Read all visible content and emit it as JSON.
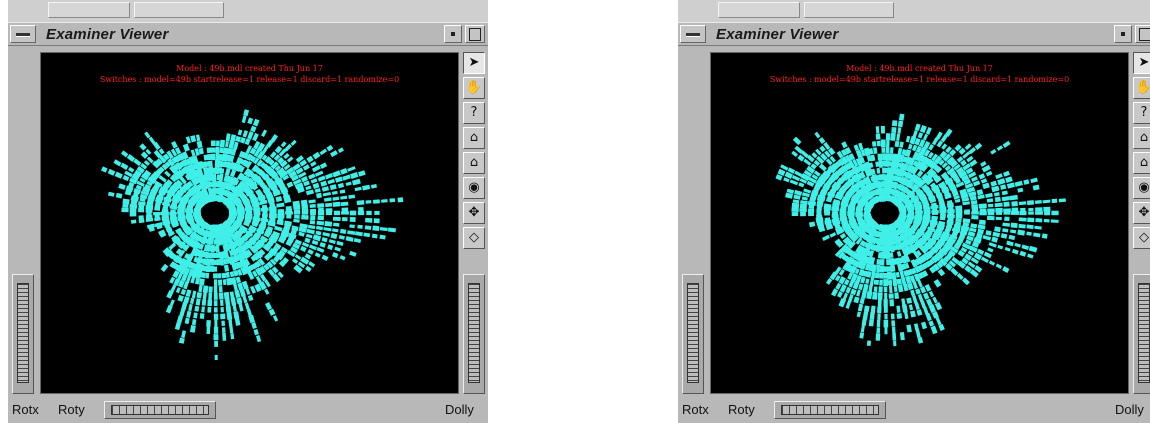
{
  "viewers": [
    {
      "title": "Examiner Viewer",
      "info_line1": "Model : 49b.mdl created Thu Jun 17",
      "info_line2": "Switches : model=49b startrelease=1 release=1 discard=1 randomize=0",
      "bottom_labels": {
        "rotx": "Rotx",
        "roty": "Roty",
        "dolly": "Dolly"
      }
    },
    {
      "title": "Examiner Viewer",
      "info_line1": "Model : 49b.mdl created Thu Jun 17",
      "info_line2": "Switches : model=49b startrelease=1 release=1 discard=1 randomize=0",
      "bottom_labels": {
        "rotx": "Rotx",
        "roty": "Roty",
        "dolly": "Dolly"
      }
    }
  ],
  "toolbar": [
    {
      "icon": "arrow-pointer-icon",
      "glyph": "➤"
    },
    {
      "icon": "hand-icon",
      "glyph": "✋"
    },
    {
      "icon": "help-icon",
      "glyph": "?"
    },
    {
      "icon": "home-icon",
      "glyph": "⌂"
    },
    {
      "icon": "set-home-icon",
      "glyph": "⌂"
    },
    {
      "icon": "view-all-eye-icon",
      "glyph": "◉"
    },
    {
      "icon": "seek-crosshair-icon",
      "glyph": "✥"
    },
    {
      "icon": "perspective-camera-icon",
      "glyph": "◇"
    }
  ],
  "colors": {
    "model": "#40f0e8",
    "info_text": "#ff2020",
    "viewport_bg": "#000000"
  }
}
